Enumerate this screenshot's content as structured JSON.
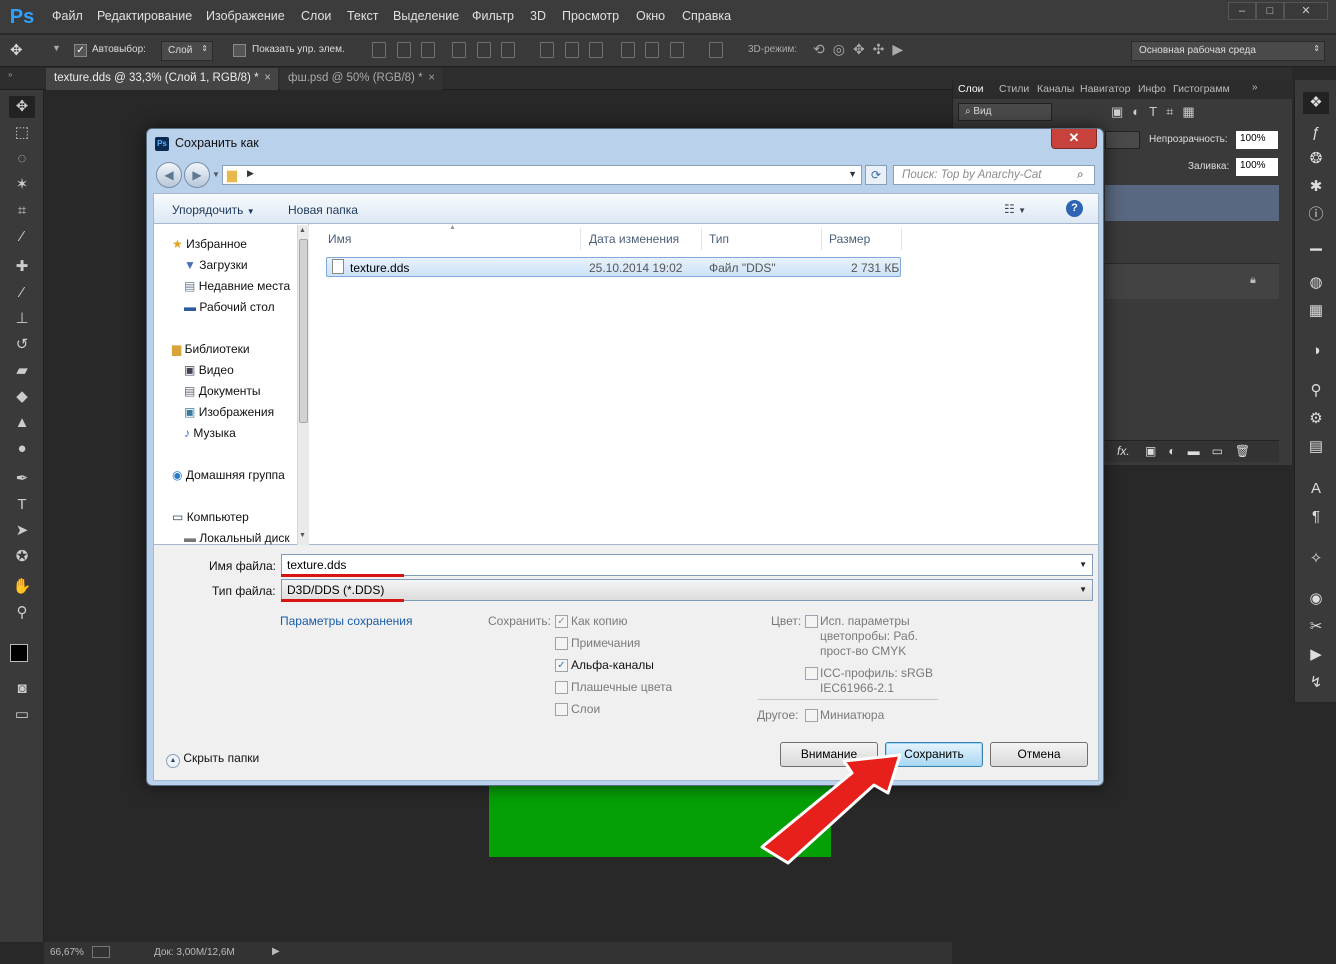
{
  "app": {
    "logo": "Ps"
  },
  "menu": [
    "Файл",
    "Редактирование",
    "Изображение",
    "Слои",
    "Текст",
    "Выделение",
    "Фильтр",
    "3D",
    "Просмотр",
    "Окно",
    "Справка"
  ],
  "window_controls": [
    "–",
    "□",
    "✕"
  ],
  "options": {
    "autoselect_label": "Автовыбор:",
    "autoselect_value": "Слой",
    "show_controls_label": "Показать упр. элем.",
    "mode_3d": "3D-режим:",
    "workspace": "Основная рабочая среда"
  },
  "doc_tabs": [
    {
      "label": "texture.dds @ 33,3% (Слой 1, RGB/8) *",
      "close": "×"
    },
    {
      "label": "фш.psd @ 50% (RGB/8) *",
      "close": "×"
    }
  ],
  "layers_panel": {
    "tabs": [
      "Слои",
      "Стили",
      "Каналы",
      "Навигатор",
      "Инфо",
      "Гистограмм"
    ],
    "filter_value": "Вид",
    "opacity_label": "Непрозрачность:",
    "opacity_value": "100%",
    "fill_label": "Заливка:",
    "fill_value": "100%",
    "fx_label": "fx."
  },
  "status": {
    "zoom": "66,67%",
    "doc": "Док: 3,00М/12,6М"
  },
  "dialog": {
    "title": "Сохранить как",
    "ps_badge": "Ps",
    "close": "✕",
    "search_placeholder": "Поиск: Top by Anarchy-Cat",
    "toolbar": {
      "organize": "Упорядочить",
      "new_folder": "Новая папка"
    },
    "nav": {
      "favorites": "Избранное",
      "favorites_items": [
        "Загрузки",
        "Недавние места",
        "Рабочий стол"
      ],
      "libraries": "Библиотеки",
      "library_items": [
        "Видео",
        "Документы",
        "Изображения",
        "Музыка"
      ],
      "homegroup": "Домашняя группа",
      "computer": "Компьютер",
      "computer_items": [
        "Локальный диск"
      ]
    },
    "columns": {
      "name": "Имя",
      "date": "Дата изменения",
      "type": "Тип",
      "size": "Размер"
    },
    "files": [
      {
        "name": "texture.dds",
        "date": "25.10.2014 19:02",
        "type": "Файл \"DDS\"",
        "size": "2 731 КБ"
      }
    ],
    "filename_label": "Имя файла:",
    "filename_value": "texture.dds",
    "filetype_label": "Тип файла:",
    "filetype_value": "D3D/DDS (*.DDS)",
    "save_params_link": "Параметры сохранения",
    "save_label": "Сохранить:",
    "save_options": [
      {
        "label": "Как копию",
        "checked": true
      },
      {
        "label": "Примечания",
        "checked": false
      },
      {
        "label": "Альфа-каналы",
        "checked": true
      },
      {
        "label": "Плашечные цвета",
        "checked": false
      },
      {
        "label": "Слои",
        "checked": false
      }
    ],
    "color_label": "Цвет:",
    "color_opt1_line1": "Исп. параметры",
    "color_opt1_line2": "цветопробы: Раб.",
    "color_opt1_line3": "прост-во CMYK",
    "color_opt2_line1": "ICC-профиль:  sRGB",
    "color_opt2_line2": "IEC61966-2.1",
    "other_label": "Другое:",
    "other_opt": "Миниатюра",
    "hide_folders": "Скрыть папки",
    "buttons": {
      "warning": "Внимание",
      "save": "Сохранить",
      "cancel": "Отмена"
    }
  },
  "colors": {
    "accent_red": "#d61414",
    "arrow_red": "#e8201c",
    "ps_blue": "#2fa0ff",
    "canvas_green": "#05a005"
  }
}
